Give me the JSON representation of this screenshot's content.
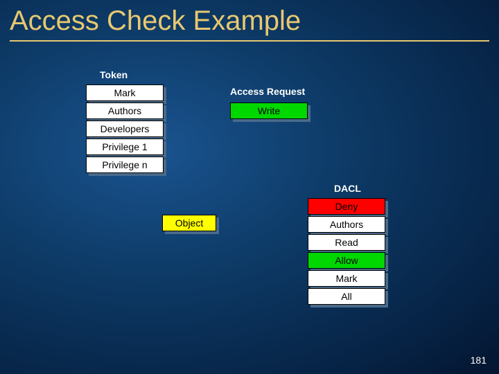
{
  "title": "Access Check Example",
  "token": {
    "label": "Token",
    "items": [
      "Mark",
      "Authors",
      "Developers",
      "Privilege 1",
      "Privilege n"
    ]
  },
  "access_request": {
    "label": "Access Request",
    "value": "Write"
  },
  "object_label": "Object",
  "dacl": {
    "label": "DACL",
    "entries": [
      {
        "text": "Deny",
        "style": "red"
      },
      {
        "text": "Authors",
        "style": "white"
      },
      {
        "text": "Read",
        "style": "white"
      },
      {
        "text": "Allow",
        "style": "green"
      },
      {
        "text": "Mark",
        "style": "white"
      },
      {
        "text": "All",
        "style": "white"
      }
    ]
  },
  "page_number": "181"
}
